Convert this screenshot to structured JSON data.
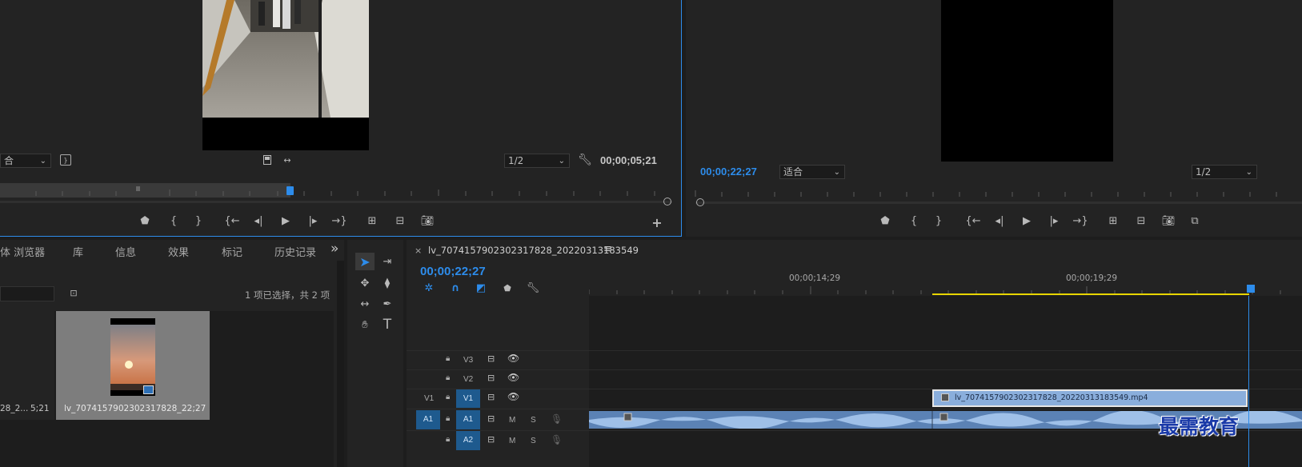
{
  "source_monitor": {
    "zoom_select": "合",
    "resolution_select": "1/2",
    "timecode": "00;00;05;21"
  },
  "program_monitor": {
    "timecode": "00;00;22;27",
    "zoom_select": "适合",
    "resolution_select": "1/2"
  },
  "project_panel": {
    "tabs": [
      "体 浏览器",
      "库",
      "信息",
      "效果",
      "标记",
      "历史记录"
    ],
    "overflow": "»",
    "selection_status": "1 项已选择，共 2 项",
    "items": [
      {
        "name": "28_2...",
        "duration": "5;21"
      },
      {
        "name": "lv_7074157902302317828_...",
        "duration": "22;27"
      }
    ]
  },
  "timeline": {
    "sequence_name": "lv_7074157902302317828_20220313183549",
    "timecode": "00;00;22;27",
    "ruler_labels": [
      "00;00;14;29",
      "00;00;19;29"
    ],
    "video_tracks": [
      {
        "src": "",
        "name": "V3"
      },
      {
        "src": "",
        "name": "V2"
      },
      {
        "src": "V1",
        "name": "V1"
      }
    ],
    "audio_tracks": [
      {
        "src": "A1",
        "name": "A1",
        "m": "M",
        "s": "S"
      },
      {
        "src": "",
        "name": "A2",
        "m": "M",
        "s": "S"
      }
    ],
    "clip_name": "lv_7074157902302317828_20220313183549.mp4"
  },
  "watermark": "最需教育",
  "colors": {
    "accent_blue": "#2d8ceb",
    "clip_video": "#8aaedc",
    "clip_audio": "#5b82b5",
    "work_area": "#e8d500"
  }
}
